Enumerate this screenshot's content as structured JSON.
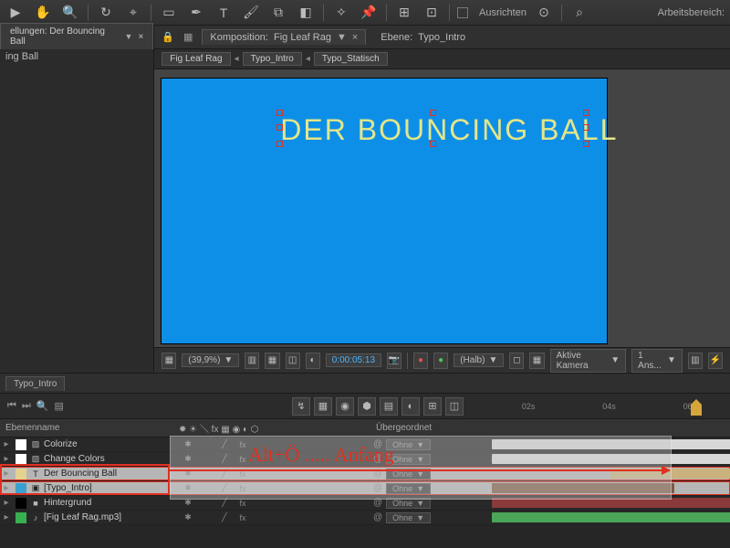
{
  "toolbar": {
    "align_label": "Ausrichten",
    "workspace_label": "Arbeitsbereich:"
  },
  "left_panel": {
    "tab_title": "ellungen: Der Bouncing Ball",
    "line1": "ing Ball"
  },
  "comp_panel": {
    "comp_prefix": "Komposition:",
    "comp_name": "Fig Leaf Rag",
    "layer_prefix": "Ebene:",
    "layer_name": "Typo_Intro"
  },
  "breadcrumb": {
    "c1": "Fig Leaf Rag",
    "c2": "Typo_Intro",
    "c3": "Typo_Statisch"
  },
  "canvas": {
    "text": "DER BOUNCING BALL"
  },
  "viewer": {
    "zoom": "(39,9%)",
    "timecode": "0:00:05:13",
    "res": "(Halb)",
    "camera": "Aktive Kamera",
    "views": "1 Ans..."
  },
  "timeline": {
    "tab": "Typo_Intro",
    "header": {
      "name": "Ebenenname",
      "parent": "Übergeordnet"
    },
    "parent_none": "Ohne",
    "layers": [
      {
        "name": "Colorize",
        "color": "#ffffff",
        "type": "adj",
        "bar_color": "#d7d7d7",
        "bar_start": 0,
        "bar_end": 265
      },
      {
        "name": "Change Colors",
        "color": "#ffffff",
        "type": "adj",
        "bar_color": "#d7d7d7",
        "bar_start": 0,
        "bar_end": 265
      },
      {
        "name": "Der Bouncing Ball",
        "color": "#e3d290",
        "type": "T",
        "bar_color": "#c9b27e",
        "bar_start": 130,
        "bar_end": 265,
        "selected": true
      },
      {
        "name": "[Typo_Intro]",
        "color": "#3aa0d0",
        "type": "comp",
        "bar_color": "#7e5a47",
        "bar_start": 0,
        "bar_end": 200,
        "selected": true
      },
      {
        "name": "Hintergrund",
        "color": "#000000",
        "type": "solid",
        "bar_color": "#8a3a3a",
        "bar_start": 0,
        "bar_end": 265
      },
      {
        "name": "[Fig Leaf Rag.mp3]",
        "color": "#38b050",
        "type": "audio",
        "bar_color": "#4aa558",
        "bar_start": 0,
        "bar_end": 265
      }
    ],
    "ruler": [
      "02s",
      "04s",
      "06s"
    ]
  },
  "annotation": {
    "text": "Alt+Ö ..... Anfang"
  }
}
